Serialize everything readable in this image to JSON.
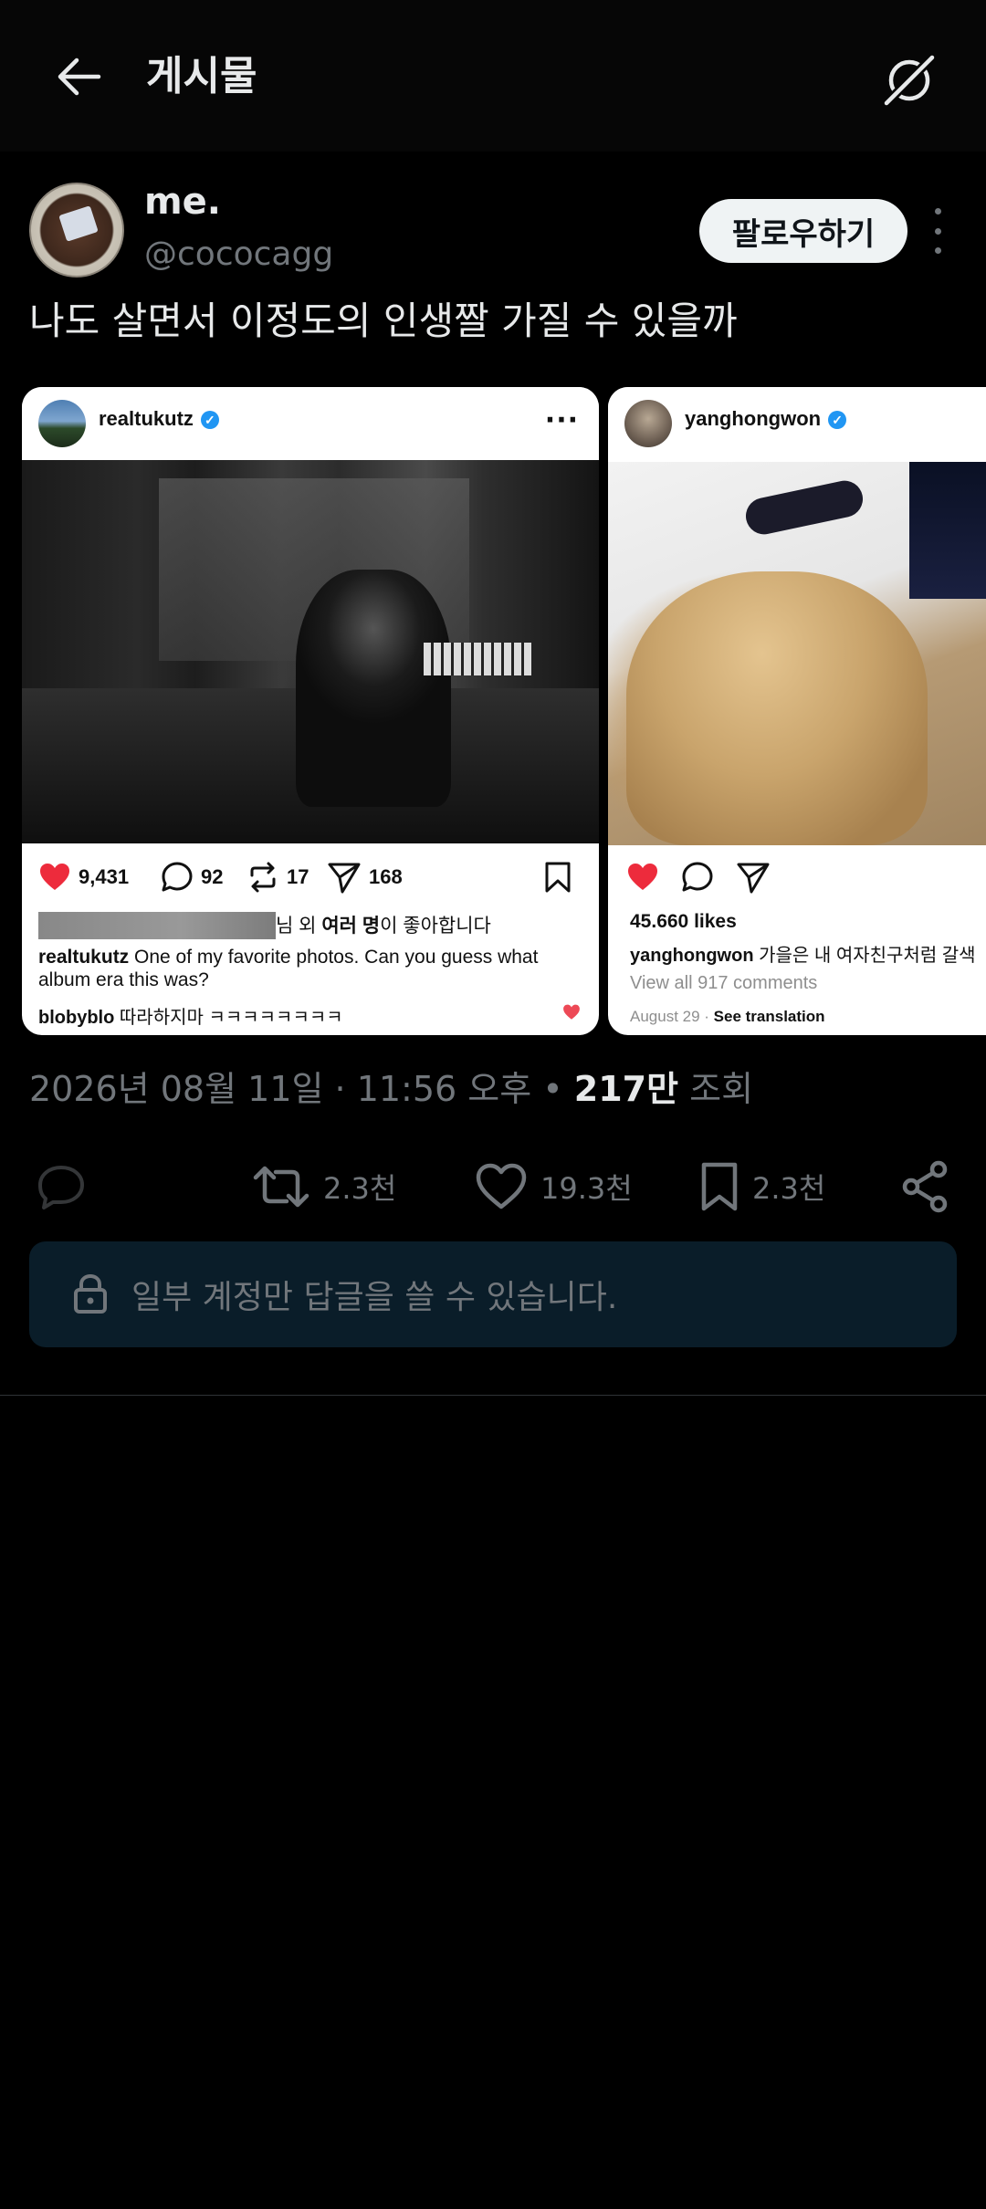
{
  "header": {
    "title": "게시물",
    "back_icon": "back-arrow-icon",
    "grok_icon": "grok-icon"
  },
  "post": {
    "author": {
      "display_name": "me.",
      "handle": "@cococagg",
      "follow_label": "팔로우하기"
    },
    "text": "나도 살면서 이정도의 인생짤 가질 수 있을까",
    "embeds": [
      {
        "username": "realtukutz",
        "verified": true,
        "likes": "9,431",
        "comments": "92",
        "reposts": "17",
        "shares": "168",
        "liked_by_suffix_a": "님 외 ",
        "liked_by_bold": "여러 명",
        "liked_by_suffix_b": "이 좋아합니다",
        "caption_user": "realtukutz",
        "caption_text": "One of my favorite photos. Can you guess what album era this was?",
        "comment_user": "blobyblo",
        "comment_text": "따라하지마 ㅋㅋㅋㅋㅋㅋㅋㅋ"
      },
      {
        "username": "yanghongwon",
        "verified": true,
        "likes_label": "45.660 likes",
        "caption_user": "yanghongwon",
        "caption_text": "가을은 내 여자친구처럼 갈색",
        "view_all": "View all 917 comments",
        "date": "August 29",
        "separator": " · ",
        "see_translation": "See translation"
      }
    ],
    "meta": {
      "timestamp": "2026년 08월 11일 · 11:56 오후",
      "dot": " • ",
      "views_count": "217만",
      "views_label": " 조회"
    },
    "engagement": {
      "retweets": "2.3천",
      "likes": "19.3천",
      "bookmarks": "2.3천"
    },
    "reply_restriction": "일부 계정만 답글을 쓸 수 있습니다."
  },
  "colors": {
    "background": "#000000",
    "text_primary": "#e7e9ea",
    "text_secondary": "#71767b",
    "follow_bg": "#eff3f4",
    "restrict_bg": "#0a1d29",
    "heart_red": "#ed2b3c",
    "verified_blue": "#2196f3"
  }
}
